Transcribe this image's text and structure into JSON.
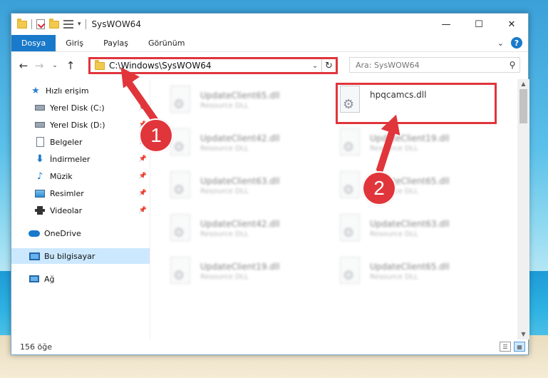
{
  "window": {
    "title": "SysWOW64"
  },
  "ribbon": {
    "tabs": [
      "Dosya",
      "Giriş",
      "Paylaş",
      "Görünüm"
    ]
  },
  "address": {
    "path": "C:\\Windows\\SysWOW64"
  },
  "search": {
    "placeholder": "Ara: SysWOW64"
  },
  "sidebar": {
    "items": [
      {
        "label": "Hızlı erişim",
        "icon": "star-icon"
      },
      {
        "label": "Yerel Disk (C:)",
        "icon": "drive-icon"
      },
      {
        "label": "Yerel Disk (D:)",
        "icon": "drive-icon"
      },
      {
        "label": "Belgeler",
        "icon": "documents-icon"
      },
      {
        "label": "İndirmeler",
        "icon": "download-icon"
      },
      {
        "label": "Müzik",
        "icon": "music-icon"
      },
      {
        "label": "Resimler",
        "icon": "pictures-icon"
      },
      {
        "label": "Videolar",
        "icon": "videos-icon"
      },
      {
        "label": "OneDrive",
        "icon": "cloud-icon"
      },
      {
        "label": "Bu bilgisayar",
        "icon": "computer-icon"
      },
      {
        "label": "Ağ",
        "icon": "network-icon"
      }
    ]
  },
  "files": {
    "left": [
      {
        "name": "UpdateClient65.dll",
        "type": "Resource DLL"
      },
      {
        "name": "UpdateClient42.dll",
        "type": "Resource DLL"
      },
      {
        "name": "UpdateClient63.dll",
        "type": "Resource DLL"
      },
      {
        "name": "UpdateClient42.dll",
        "type": "Resource DLL"
      },
      {
        "name": "UpdateClient19.dll",
        "type": "Resource DLL"
      }
    ],
    "right": [
      {
        "name": "hpqcamcs.dll",
        "type": ""
      },
      {
        "name": "UpdateClient19.dll",
        "type": "Resource DLL"
      },
      {
        "name": "UpdateClient65.dll",
        "type": "Resource DLL"
      },
      {
        "name": "UpdateClient63.dll",
        "type": "Resource DLL"
      },
      {
        "name": "UpdateClient65.dll",
        "type": "Resource DLL"
      }
    ]
  },
  "status": {
    "item_count": "156 öğe"
  },
  "annotations": {
    "step1": "1",
    "step2": "2"
  },
  "colors": {
    "accent": "#1979ca",
    "annotation": "#e0353b",
    "selected": "#cce8ff"
  }
}
